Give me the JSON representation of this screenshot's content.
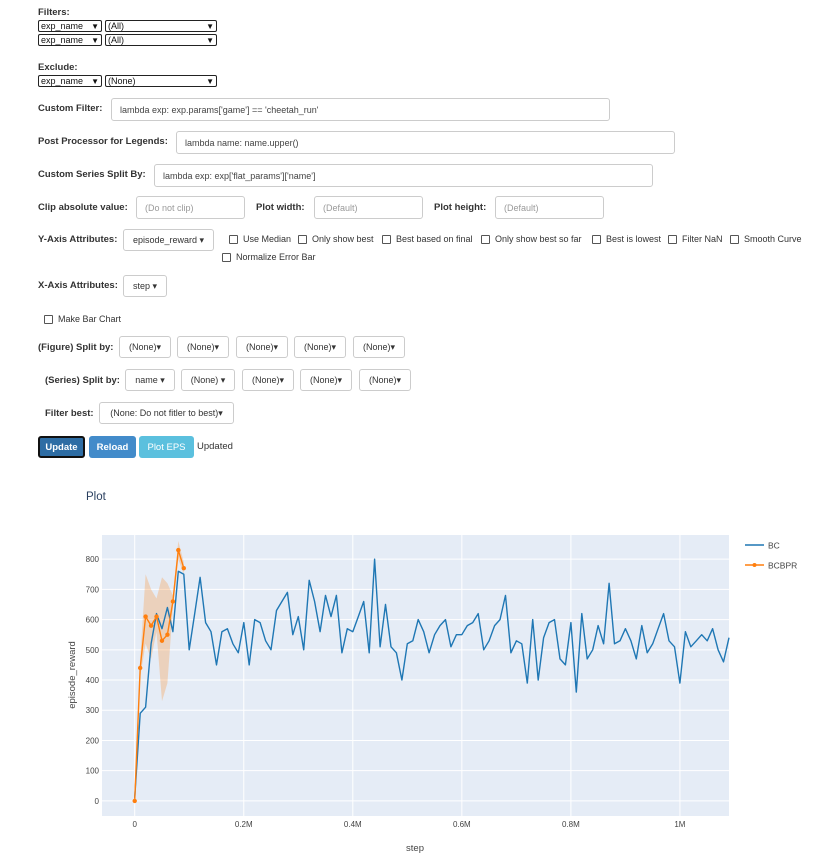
{
  "filters": {
    "label": "Filters:",
    "rows": [
      {
        "key": "exp_name",
        "value": "(All)"
      },
      {
        "key": "exp_name",
        "value": "(All)"
      }
    ]
  },
  "exclude": {
    "label": "Exclude:",
    "key": "exp_name",
    "value": "(None)"
  },
  "custom_filter": {
    "label": "Custom Filter:",
    "value": "lambda exp: exp.params['game'] == 'cheetah_run'"
  },
  "legend_post": {
    "label": "Post Processor for Legends:",
    "value": "lambda name: name.upper()"
  },
  "series_split_custom": {
    "label": "Custom Series Split By:",
    "value": "lambda exp: exp['flat_params']['name']"
  },
  "clip": {
    "label": "Clip absolute value:",
    "placeholder": "(Do not clip)"
  },
  "plot_width": {
    "label": "Plot width:",
    "placeholder": "(Default)"
  },
  "plot_height": {
    "label": "Plot height:",
    "placeholder": "(Default)"
  },
  "y_axis": {
    "label": "Y-Axis Attributes:",
    "value": "episode_reward",
    "options": [
      "Use Median",
      "Only show best",
      "Best based on final",
      "Only show best so far",
      "Best is lowest",
      "Filter NaN",
      "Smooth Curve",
      "Normalize Error Bar"
    ]
  },
  "x_axis": {
    "label": "X-Axis Attributes:",
    "value": "step"
  },
  "bar_chart": {
    "label": "Make Bar Chart"
  },
  "figure_split": {
    "label": "(Figure) Split by:",
    "values": [
      "(None)",
      "(None)",
      "(None)",
      "(None)",
      "(None)"
    ]
  },
  "series_split": {
    "label": "(Series) Split by:",
    "values": [
      "name",
      "(None)",
      "(None)",
      "(None)",
      "(None)"
    ]
  },
  "filter_best": {
    "label": "Filter best:",
    "value": "(None: Do not fitler to best)"
  },
  "buttons": {
    "update": "Update",
    "reload": "Reload",
    "plot_eps": "Plot EPS",
    "status": "Updated"
  },
  "colors": {
    "update": "#2e6da4",
    "reload": "#428bca",
    "plot_eps": "#5bc0de",
    "bc": "#1f77b4",
    "bcbpr": "#ff7f0e",
    "plot_bg": "#e5ecf6"
  },
  "chart_data": {
    "type": "line",
    "title": "Plot",
    "xlabel": "step",
    "ylabel": "episode_reward",
    "xlim": [
      -60000,
      1090000
    ],
    "ylim": [
      -50,
      880
    ],
    "x_ticks": [
      0,
      200000,
      400000,
      600000,
      800000,
      1000000
    ],
    "x_tick_labels": [
      "0",
      "0.2M",
      "0.4M",
      "0.6M",
      "0.8M",
      "1M"
    ],
    "y_ticks": [
      0,
      100,
      200,
      300,
      400,
      500,
      600,
      700,
      800
    ],
    "legend_position": "top-right",
    "grid": true,
    "series": [
      {
        "name": "BC",
        "x": [
          0,
          10000,
          20000,
          30000,
          40000,
          50000,
          60000,
          70000,
          80000,
          90000,
          100000,
          110000,
          120000,
          130000,
          140000,
          150000,
          160000,
          170000,
          180000,
          190000,
          200000,
          210000,
          220000,
          230000,
          240000,
          250000,
          260000,
          270000,
          280000,
          290000,
          300000,
          310000,
          320000,
          330000,
          340000,
          350000,
          360000,
          370000,
          380000,
          390000,
          400000,
          410000,
          420000,
          430000,
          440000,
          450000,
          460000,
          470000,
          480000,
          490000,
          500000,
          510000,
          520000,
          530000,
          540000,
          550000,
          560000,
          570000,
          580000,
          590000,
          600000,
          610000,
          620000,
          630000,
          640000,
          650000,
          660000,
          670000,
          680000,
          690000,
          700000,
          710000,
          720000,
          730000,
          740000,
          750000,
          760000,
          770000,
          780000,
          790000,
          800000,
          810000,
          820000,
          830000,
          840000,
          850000,
          860000,
          870000,
          880000,
          890000,
          900000,
          910000,
          920000,
          930000,
          940000,
          950000,
          960000,
          970000,
          980000,
          990000,
          1000000,
          1010000,
          1020000,
          1030000,
          1040000,
          1050000,
          1060000,
          1070000,
          1080000,
          1090000
        ],
        "values": [
          10,
          290,
          310,
          520,
          620,
          570,
          640,
          560,
          760,
          750,
          500,
          620,
          740,
          590,
          560,
          450,
          560,
          570,
          520,
          490,
          590,
          450,
          600,
          590,
          530,
          500,
          630,
          660,
          690,
          550,
          610,
          500,
          730,
          660,
          560,
          680,
          610,
          680,
          490,
          570,
          560,
          610,
          660,
          490,
          800,
          510,
          650,
          510,
          490,
          400,
          520,
          530,
          600,
          560,
          490,
          550,
          580,
          600,
          510,
          550,
          550,
          580,
          590,
          620,
          500,
          530,
          580,
          600,
          680,
          490,
          530,
          520,
          390,
          600,
          400,
          540,
          590,
          600,
          470,
          450,
          590,
          360,
          620,
          470,
          500,
          580,
          520,
          720,
          520,
          530,
          570,
          530,
          470,
          580,
          490,
          520,
          570,
          620,
          530,
          510,
          390,
          560,
          510,
          530,
          550,
          530,
          570,
          500,
          460,
          540
        ]
      },
      {
        "name": "BCBPR",
        "x": [
          0,
          10000,
          20000,
          30000,
          40000,
          50000,
          60000,
          70000,
          80000,
          90000
        ],
        "values": [
          0,
          440,
          610,
          580,
          610,
          530,
          550,
          660,
          830,
          770
        ],
        "upper": [
          0,
          470,
          750,
          700,
          670,
          740,
          720,
          680,
          860,
          790
        ],
        "lower": [
          0,
          410,
          520,
          470,
          560,
          330,
          390,
          640,
          800,
          750
        ]
      }
    ]
  }
}
